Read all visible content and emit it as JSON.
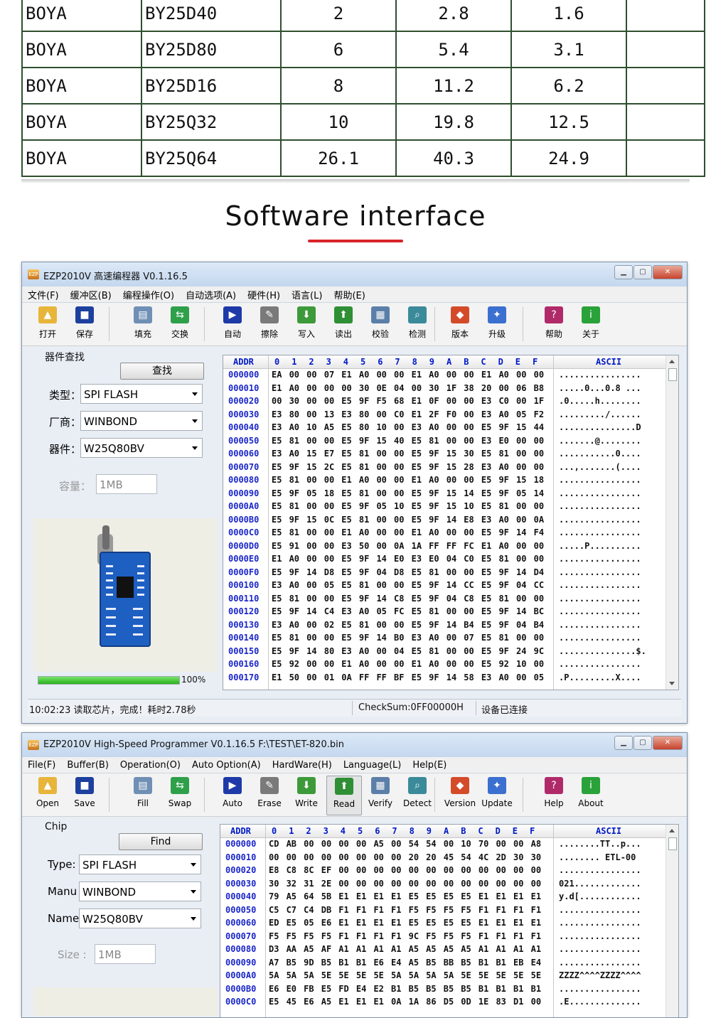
{
  "spec_table": {
    "rows": [
      [
        "BOYA",
        "BY25D40",
        "2",
        "2.8",
        "1.6",
        ""
      ],
      [
        "BOYA",
        "BY25D80",
        "6",
        "5.4",
        "3.1",
        ""
      ],
      [
        "BOYA",
        "BY25D16",
        "8",
        "11.2",
        "6.2",
        ""
      ],
      [
        "BOYA",
        "BY25Q32",
        "10",
        "19.8",
        "12.5",
        ""
      ],
      [
        "BOYA",
        "BY25Q64",
        "26.1",
        "40.3",
        "24.9",
        ""
      ]
    ]
  },
  "heading": "Software interface",
  "win1": {
    "title": "EZP2010V 高速编程器  V0.1.16.5",
    "menu": [
      "文件(F)",
      "缓冲区(B)",
      "编程操作(O)",
      "自动选项(A)",
      "硬件(H)",
      "语言(L)",
      "帮助(E)"
    ],
    "tools": [
      "打开",
      "保存",
      "填充",
      "交换",
      "自动",
      "擦除",
      "写入",
      "读出",
      "校验",
      "检测",
      "版本",
      "升级",
      "帮助",
      "关于"
    ],
    "group": "器件查找",
    "find": "查找",
    "type_label": "类型：",
    "type_value": "SPI FLASH",
    "maker_label": "厂商：",
    "maker_value": "WINBOND",
    "device_label": "器件：",
    "device_value": "W25Q80BV",
    "size_label": "容量：",
    "size_value": "1MB",
    "progress_pct": "100%",
    "status_msg": "10:02:23 读取芯片，完成！耗时2.78秒",
    "checksum": "CheckSum:0FF00000H",
    "connected": "设备已连接"
  },
  "win2": {
    "title": "EZP2010V High-Speed Programmer  V0.1.16.5     F:\\TEST\\ET-820.bin",
    "menu": [
      "File(F)",
      "Buffer(B)",
      "Operation(O)",
      "Auto Option(A)",
      "HardWare(H)",
      "Language(L)",
      "Help(E)"
    ],
    "tools": [
      "Open",
      "Save",
      "Fill",
      "Swap",
      "Auto",
      "Erase",
      "Write",
      "Read",
      "Verify",
      "Detect",
      "Version",
      "Update",
      "Help",
      "About"
    ],
    "group": "Chip",
    "find": "Find",
    "type_label": "Type:",
    "type_value": "SPI FLASH",
    "maker_label": "Manu",
    "maker_value": "WINBOND",
    "device_label": "Name",
    "device_value": "W25Q80BV",
    "size_label": "Size :",
    "size_value": "1MB"
  },
  "hex_header": {
    "addr": "ADDR",
    "cols": [
      "0",
      "1",
      "2",
      "3",
      "4",
      "5",
      "6",
      "7",
      "8",
      "9",
      "A",
      "B",
      "C",
      "D",
      "E",
      "F"
    ],
    "ascii": "ASCII"
  },
  "hex1": [
    {
      "a": "000000",
      "b": "EA 00 00 07 E1 A0 00 00 E1 A0 00 00 E1 A0 00 00",
      "s": "................"
    },
    {
      "a": "000010",
      "b": "E1 A0 00 00 00 30 0E 04 00 30 1F 38 20 00 06 B8",
      "s": ".....0...0.8 ..."
    },
    {
      "a": "000020",
      "b": "00 30 00 00 E5 9F F5 68 E1 0F 00 00 E3 C0 00 1F",
      "s": ".0.....h........"
    },
    {
      "a": "000030",
      "b": "E3 80 00 13 E3 80 00 C0 E1 2F F0 00 E3 A0 05 F2",
      "s": "........./......"
    },
    {
      "a": "000040",
      "b": "E3 A0 10 A5 E5 80 10 00 E3 A0 00 00 E5 9F 15 44",
      "s": "...............D"
    },
    {
      "a": "000050",
      "b": "E5 81 00 00 E5 9F 15 40 E5 81 00 00 E3 E0 00 00",
      "s": ".......@........"
    },
    {
      "a": "000060",
      "b": "E3 A0 15 E7 E5 81 00 00 E5 9F 15 30 E5 81 00 00",
      "s": "...........0...."
    },
    {
      "a": "000070",
      "b": "E5 9F 15 2C E5 81 00 00 E5 9F 15 28 E3 A0 00 00",
      "s": "...,.......(...."
    },
    {
      "a": "000080",
      "b": "E5 81 00 00 E1 A0 00 00 E1 A0 00 00 E5 9F 15 18",
      "s": "................"
    },
    {
      "a": "000090",
      "b": "E5 9F 05 18 E5 81 00 00 E5 9F 15 14 E5 9F 05 14",
      "s": "................"
    },
    {
      "a": "0000A0",
      "b": "E5 81 00 00 E5 9F 05 10 E5 9F 15 10 E5 81 00 00",
      "s": "................"
    },
    {
      "a": "0000B0",
      "b": "E5 9F 15 0C E5 81 00 00 E5 9F 14 E8 E3 A0 00 0A",
      "s": "................"
    },
    {
      "a": "0000C0",
      "b": "E5 81 00 00 E1 A0 00 00 E1 A0 00 00 E5 9F 14 F4",
      "s": "................"
    },
    {
      "a": "0000D0",
      "b": "E5 91 00 00 E3 50 00 0A 1A FF FF FC E1 A0 00 00",
      "s": ".....P.........."
    },
    {
      "a": "0000E0",
      "b": "E1 A0 00 00 E5 9F 14 E0 E3 E0 04 C0 E5 81 00 00",
      "s": "................"
    },
    {
      "a": "0000F0",
      "b": "E5 9F 14 D8 E5 9F 04 D8 E5 81 00 00 E5 9F 14 D4",
      "s": "................"
    },
    {
      "a": "000100",
      "b": "E3 A0 00 05 E5 81 00 00 E5 9F 14 CC E5 9F 04 CC",
      "s": "................"
    },
    {
      "a": "000110",
      "b": "E5 81 00 00 E5 9F 14 C8 E5 9F 04 C8 E5 81 00 00",
      "s": "................"
    },
    {
      "a": "000120",
      "b": "E5 9F 14 C4 E3 A0 05 FC E5 81 00 00 E5 9F 14 BC",
      "s": "................"
    },
    {
      "a": "000130",
      "b": "E3 A0 00 02 E5 81 00 00 E5 9F 14 B4 E5 9F 04 B4",
      "s": "................"
    },
    {
      "a": "000140",
      "b": "E5 81 00 00 E5 9F 14 B0 E3 A0 00 07 E5 81 00 00",
      "s": "................"
    },
    {
      "a": "000150",
      "b": "E5 9F 14 80 E3 A0 00 04 E5 81 00 00 E5 9F 24 9C",
      "s": "...............$."
    },
    {
      "a": "000160",
      "b": "E5 92 00 00 E1 A0 00 00 E1 A0 00 00 E5 92 10 00",
      "s": "................"
    },
    {
      "a": "000170",
      "b": "E1 50 00 01 0A FF FF BF E5 9F 14 58 E3 A0 00 05",
      "s": ".P.........X...."
    }
  ],
  "hex2": [
    {
      "a": "000000",
      "b": "CD AB 00 00 00 00 A5 00 54 54 00 10 70 00 00 A8",
      "s": "........TT..p..."
    },
    {
      "a": "000010",
      "b": "00 00 00 00 00 00 00 00 20 20 45 54 4C 2D 30 30",
      "s": "........  ETL-00"
    },
    {
      "a": "000020",
      "b": "E8 C8 8C EF 00 00 00 00 00 00 00 00 00 00 00 00",
      "s": "................"
    },
    {
      "a": "000030",
      "b": "30 32 31 2E 00 00 00 00 00 00 00 00 00 00 00 00",
      "s": "021............."
    },
    {
      "a": "000040",
      "b": "79 A5 64 5B E1 E1 E1 E1 E5 E5 E5 E5 E1 E1 E1 E1",
      "s": "y.d[............"
    },
    {
      "a": "000050",
      "b": "C5 C7 C4 DB F1 F1 F1 F1 F5 F5 F5 F5 F1 F1 F1 F1",
      "s": "................"
    },
    {
      "a": "000060",
      "b": "ED E5 05 E6 E1 E1 E1 E1 E5 E5 E5 E5 E1 E1 E1 E1",
      "s": "................"
    },
    {
      "a": "000070",
      "b": "F5 F5 F5 F5 F1 F1 F1 F1 9C F5 F5 F5 F1 F1 F1 F1",
      "s": "................"
    },
    {
      "a": "000080",
      "b": "D3 AA A5 AF A1 A1 A1 A1 A5 A5 A5 A5 A1 A1 A1 A1",
      "s": "................"
    },
    {
      "a": "000090",
      "b": "A7 B5 9D B5 B1 B1 E6 E4 A5 B5 BB B5 B1 B1 EB E4",
      "s": "................"
    },
    {
      "a": "0000A0",
      "b": "5A 5A 5A 5E 5E 5E 5E 5A 5A 5A 5A 5E 5E 5E 5E 5E",
      "s": "ZZZZ^^^^ZZZZ^^^^"
    },
    {
      "a": "0000B0",
      "b": "E6 E0 FB E5 FD E4 E2 B1 B5 B5 B5 B5 B1 B1 B1 B1",
      "s": "................"
    },
    {
      "a": "0000C0",
      "b": "E5 45 E6 A5 E1 E1 E1 0A 1A 86 D5 0D 1E 83 D1 00",
      "s": ".E.............."
    }
  ]
}
